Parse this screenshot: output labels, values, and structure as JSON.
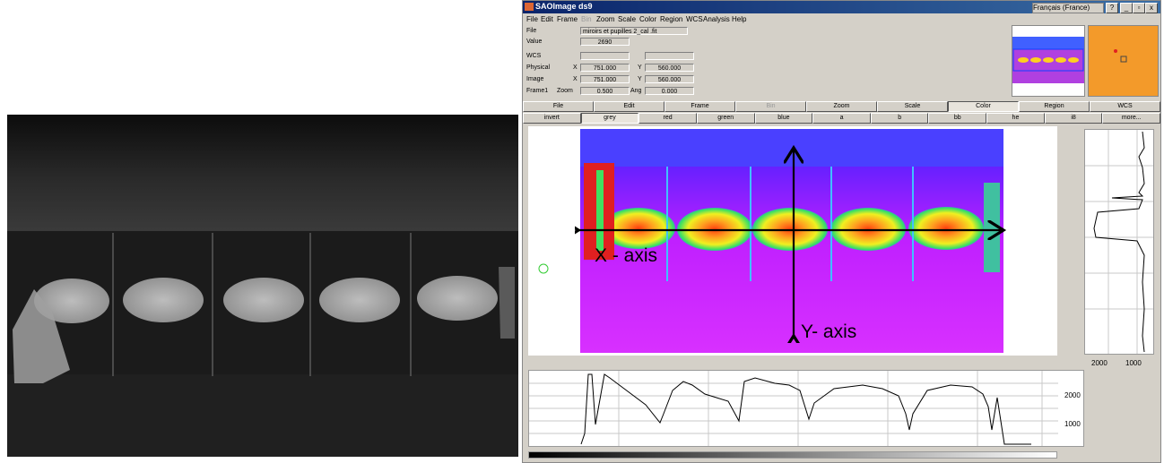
{
  "window": {
    "title": "SAOImage ds9",
    "language": "Français (France)",
    "help_glyph": "?",
    "controls": [
      "_",
      "▫",
      "x"
    ]
  },
  "menubar": [
    {
      "label": "File",
      "enabled": true
    },
    {
      "label": "Edit",
      "enabled": true
    },
    {
      "label": "Frame",
      "enabled": true
    },
    {
      "label": "Bin",
      "enabled": false
    },
    {
      "label": "Zoom",
      "enabled": true
    },
    {
      "label": "Scale",
      "enabled": true
    },
    {
      "label": "Color",
      "enabled": true
    },
    {
      "label": "Region",
      "enabled": true
    },
    {
      "label": "WCS",
      "enabled": true
    },
    {
      "label": "Analysis",
      "enabled": true
    },
    {
      "label": "Help",
      "enabled": true
    }
  ],
  "info": {
    "file_label": "File",
    "file_value": "miroirs et pupilles 2_cal .fit",
    "value_label": "Value",
    "value_value": "2690",
    "wcs_label": "WCS",
    "physical_label": "Physical",
    "image_label": "Image",
    "x_label": "X",
    "y_label": "Y",
    "physical_x": "751.000",
    "physical_y": "560.000",
    "image_x": "751.000",
    "image_y": "560.000",
    "frame_label": "Frame1",
    "zoom_label": "Zoom",
    "zoom_value": "0.500",
    "ang_label": "Ang",
    "ang_value": "0.000"
  },
  "buttonbar1": [
    "File",
    "Edit",
    "Frame",
    "Bin",
    "Zoom",
    "Scale",
    "Color",
    "Region",
    "WCS"
  ],
  "buttonbar1_active": "Color",
  "buttonbar1_disabled": "Bin",
  "buttonbar2": [
    "invert",
    "grey",
    "red",
    "green",
    "blue",
    "a",
    "b",
    "bb",
    "he",
    "i8",
    "more..."
  ],
  "buttonbar2_active": "grey",
  "annotations": {
    "x_axis": "X  - axis",
    "y_axis": "Y- axis"
  },
  "vert_graph": {
    "tick_labels": [
      "2000",
      "1000"
    ]
  },
  "horiz_graph": {
    "tick_labels": [
      "2000",
      "1000"
    ]
  },
  "colors": {
    "title_bar": "#0a246a",
    "panel": "#d4d0c8",
    "region_circle": "#33cc33"
  }
}
